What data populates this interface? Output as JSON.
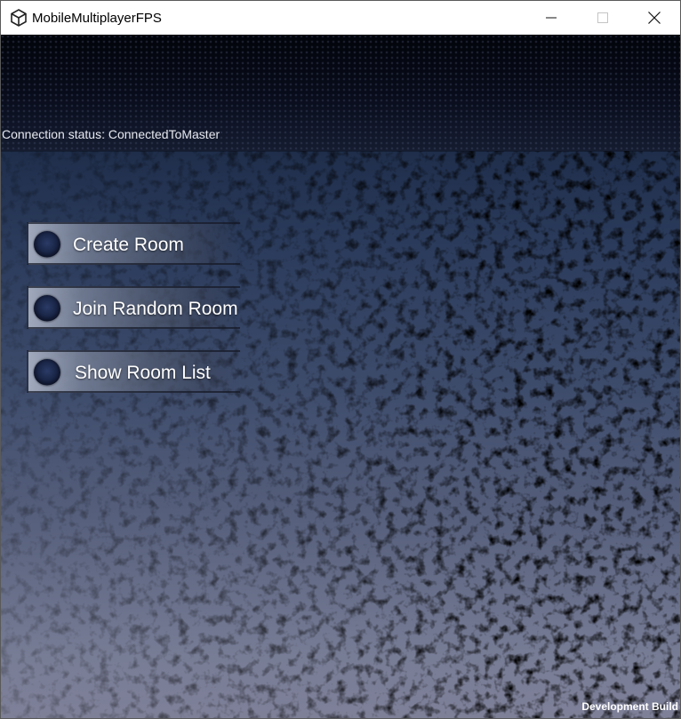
{
  "window": {
    "title": "MobileMultiplayerFPS",
    "app_icon": "unity-icon",
    "controls": {
      "minimize_icon": "minimize-icon",
      "maximize_icon": "maximize-icon",
      "close_icon": "close-icon"
    }
  },
  "game": {
    "connection_status": "Connection status: ConnectedToMaster",
    "menu": {
      "create_room": "Create Room",
      "join_random_room": "Join Random Room",
      "show_room_list": "Show Room List"
    },
    "footer": "Development Build"
  },
  "colors": {
    "background_top": "#03050c",
    "background_mid": "#2a3a5a",
    "background_bottom": "#7e8098",
    "text": "#ffffff"
  }
}
